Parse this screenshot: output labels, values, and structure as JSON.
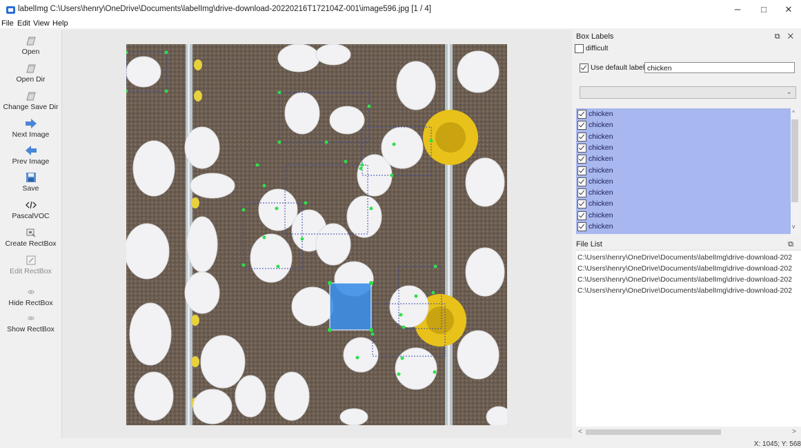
{
  "window": {
    "title": "labelImg C:\\Users\\henry\\OneDrive\\Documents\\labelImg\\drive-download-20220216T172104Z-001\\image596.jpg [1 / 4]",
    "minimize_glyph": "–",
    "maximize_glyph": "□",
    "close_glyph": "✕"
  },
  "menu": [
    "File",
    "Edit",
    "View",
    "Help"
  ],
  "toolbar": [
    {
      "label": "Open",
      "icon": "folder-open-icon",
      "enabled": true
    },
    {
      "label": "Open Dir",
      "icon": "folder-open-icon",
      "enabled": true
    },
    {
      "label": "Change Save Dir",
      "icon": "folder-open-icon",
      "enabled": true
    },
    {
      "label": "Next Image",
      "icon": "arrow-right-icon",
      "enabled": true
    },
    {
      "label": "Prev Image",
      "icon": "arrow-left-icon",
      "enabled": true
    },
    {
      "label": "Save",
      "icon": "save-icon",
      "enabled": true
    },
    {
      "label": "PascalVOC",
      "icon": "code-format-icon",
      "enabled": true
    },
    {
      "label": "Create RectBox",
      "icon": "create-rect-icon",
      "enabled": true
    },
    {
      "label": "Edit RectBox",
      "icon": "edit-rect-icon",
      "enabled": false
    },
    {
      "label": "Hide RectBox",
      "icon": "eye-icon",
      "enabled": true
    },
    {
      "label": "Show RectBox",
      "icon": "eye-icon",
      "enabled": true
    }
  ],
  "box_labels": {
    "title": "Box Labels",
    "difficult_label": "difficult",
    "use_default_label": "Use default label",
    "default_label_value": "chicken",
    "labels": [
      "chicken",
      "chicken",
      "chicken",
      "chicken",
      "chicken",
      "chicken",
      "chicken",
      "chicken",
      "chicken",
      "chicken",
      "chicken"
    ]
  },
  "file_list": {
    "title": "File List",
    "files": [
      "C:\\Users\\henry\\OneDrive\\Documents\\labelImg\\drive-download-202",
      "C:\\Users\\henry\\OneDrive\\Documents\\labelImg\\drive-download-202",
      "C:\\Users\\henry\\OneDrive\\Documents\\labelImg\\drive-download-202",
      "C:\\Users\\henry\\OneDrive\\Documents\\labelImg\\drive-download-202"
    ]
  },
  "status": {
    "coords": "X: 1045; Y: 568"
  },
  "colors": {
    "label_list_bg": "#a8b7ef",
    "selected_box": "#3d8ee6",
    "point": "#2ee04a",
    "box_outline": "#3a4aa8"
  }
}
